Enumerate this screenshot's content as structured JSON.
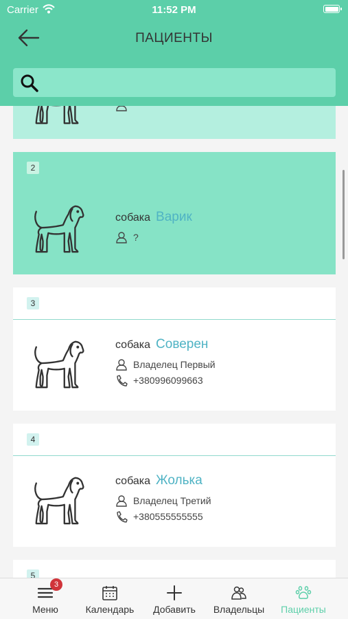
{
  "status_bar": {
    "carrier": "Carrier",
    "time": "11:52 PM"
  },
  "header": {
    "title": "ПАЦИЕНТЫ"
  },
  "search": {
    "placeholder": "",
    "value": ""
  },
  "patients": [
    {
      "number": "",
      "species": "",
      "name": "",
      "owner": ""
    },
    {
      "number": "2",
      "species": "собака",
      "name": "Варик",
      "owner": "?"
    },
    {
      "number": "3",
      "species": "собака",
      "name": "Соверен",
      "owner": "Владелец Первый",
      "phone": "+380996099663"
    },
    {
      "number": "4",
      "species": "собака",
      "name": "Жолька",
      "owner": "Владелец Третий",
      "phone": "+380555555555"
    },
    {
      "number": "5"
    }
  ],
  "tabbar": {
    "items": [
      {
        "label": "Меню",
        "icon": "menu-icon",
        "badge": "3"
      },
      {
        "label": "Календарь",
        "icon": "calendar-icon"
      },
      {
        "label": "Добавить",
        "icon": "plus-icon"
      },
      {
        "label": "Владельцы",
        "icon": "owners-icon"
      },
      {
        "label": "Пациенты",
        "icon": "paw-icon",
        "active": true
      }
    ]
  },
  "colors": {
    "accent": "#5ccfa9",
    "name_link": "#4fb3c4",
    "selected_card": "#86e3c6",
    "badge": "#d0343a"
  }
}
